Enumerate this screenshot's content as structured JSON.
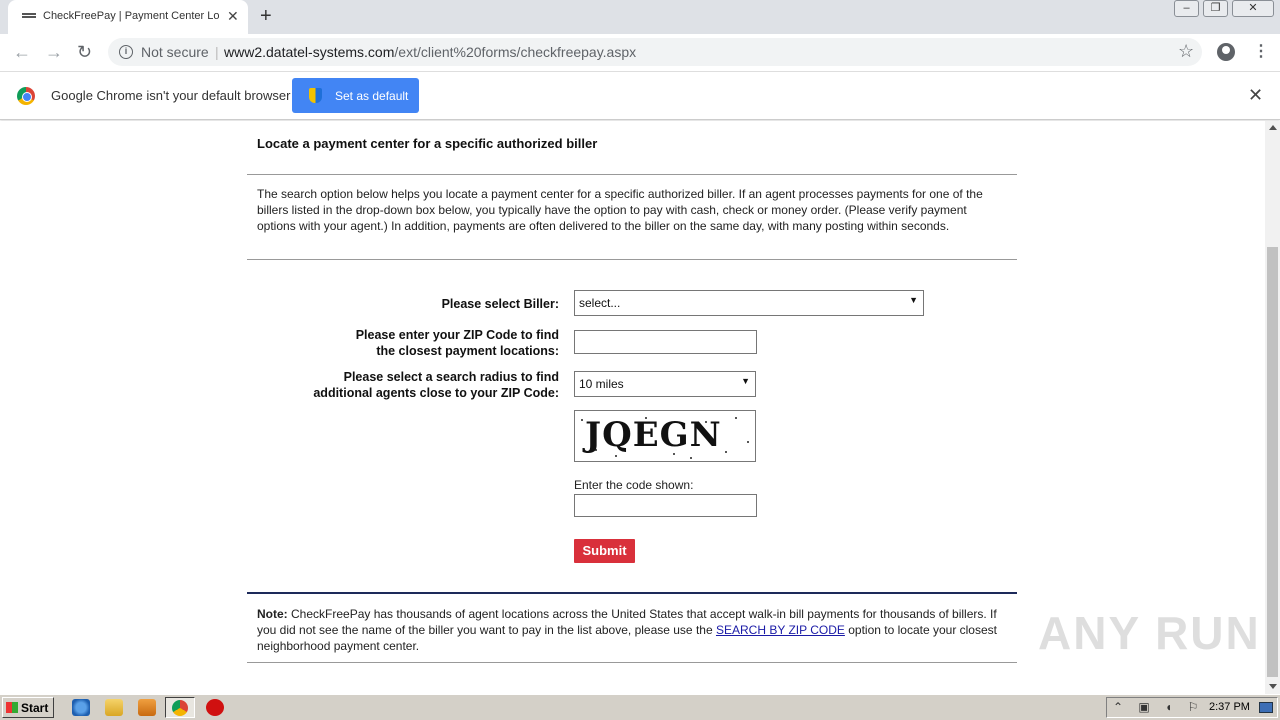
{
  "browser": {
    "tab_title": "CheckFreePay | Payment Center Lo",
    "new_tab_label": "+",
    "security_label": "Not secure",
    "separator": "|",
    "url_host": "www2.datatel-systems.com",
    "url_path": "/ext/client%20forms/checkfreepay.aspx"
  },
  "infobar": {
    "message": "Google Chrome isn't your default browser",
    "button_label": "Set as default"
  },
  "page": {
    "heading": "Locate a payment center for a specific authorized biller",
    "intro": "The search option below helps you locate a payment center for a specific authorized biller. If an agent processes payments for one of the billers listed in the drop-down box below, you typically have the option to pay with cash, check or money order. (Please verify payment options with your agent.) In addition, payments are often delivered to the biller on the same day, with many posting within seconds.",
    "biller_label": "Please select Biller:",
    "biller_value": "select...",
    "zip_label_line1": "Please enter your ZIP Code to find",
    "zip_label_line2": "the closest payment locations:",
    "zip_value": "",
    "radius_label_line1": "Please select a search radius to find",
    "radius_label_line2": "additional agents close to your ZIP Code:",
    "radius_value": "10 miles",
    "captcha_text": "JQEGN",
    "code_label": "Enter the code shown:",
    "code_value": "",
    "submit_label": "Submit",
    "note_bold": "Note:",
    "note_text_1": " CheckFreePay has thousands of agent locations across the United States that accept walk-in bill payments for thousands of billers. If you did not see the name of the biller you want to pay in the list above, please use the ",
    "note_link": "SEARCH BY ZIP CODE",
    "note_text_2": " option to locate your closest neighborhood payment center."
  },
  "watermark": "ANY RUN",
  "taskbar": {
    "start_label": "Start",
    "clock": "2:37 PM"
  },
  "colors": {
    "submit": "#d9303b",
    "set_default": "#4285f4",
    "link": "#1a1aa6",
    "divider_dark": "#1d2a5a"
  }
}
